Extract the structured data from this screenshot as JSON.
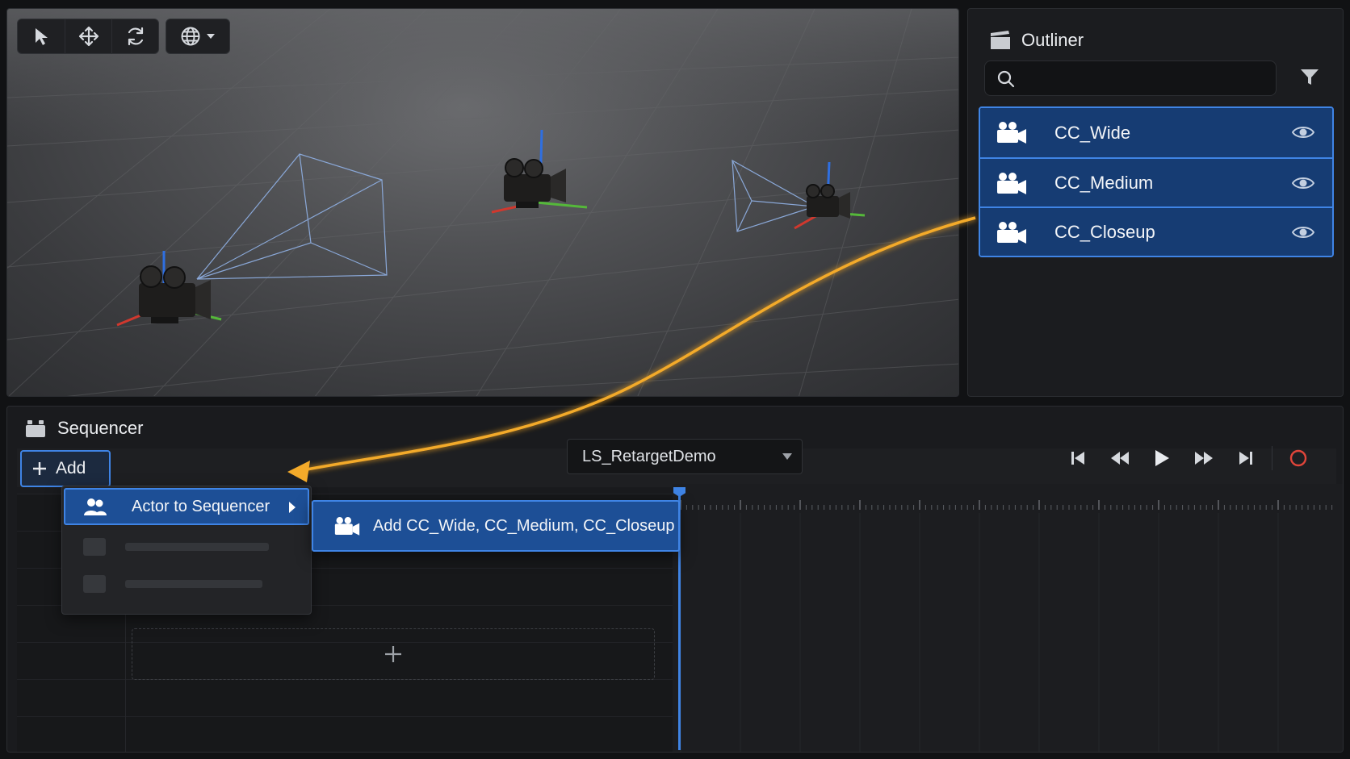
{
  "viewport": {
    "tools": [
      "select-arrow-icon",
      "move-icon",
      "rotate-icon",
      "globe-icon"
    ]
  },
  "outliner": {
    "title": "Outliner",
    "search": {
      "value": "",
      "placeholder": ""
    },
    "items": [
      {
        "label": "CC_Wide",
        "icon": "camera-icon",
        "visible": true,
        "selected": true
      },
      {
        "label": "CC_Medium",
        "icon": "camera-icon",
        "visible": true,
        "selected": true
      },
      {
        "label": "CC_Closeup",
        "icon": "camera-icon",
        "visible": true,
        "selected": true
      }
    ]
  },
  "sequencer": {
    "title": "Sequencer",
    "add_label": "Add",
    "sequence_name": "LS_RetargetDemo",
    "transport": [
      "skip-to-start-icon",
      "step-back-icon",
      "play-icon",
      "step-forward-icon",
      "skip-to-end-icon",
      "record-icon"
    ]
  },
  "context_menu": {
    "item": "Actor to Sequencer",
    "submenu_item": "Add CC_Wide, CC_Medium, CC_Closeup"
  },
  "colors": {
    "accent": "#3f84e5",
    "selection": "#163c73",
    "drag_arrow": "#f0a422",
    "record": "#e0453a"
  }
}
